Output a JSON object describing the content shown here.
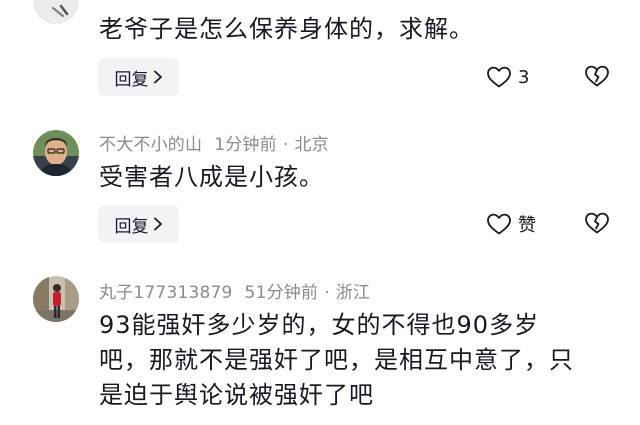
{
  "comments": [
    {
      "author": "",
      "time": "",
      "location": "",
      "text": "老爷子是怎么保养身体的，求解。",
      "reply_label": "回复",
      "like_count": "3"
    },
    {
      "author": "不大不小的山",
      "time": "1分钟前",
      "dot": "·",
      "location": "北京",
      "text": "受害者八成是小孩。",
      "reply_label": "回复",
      "like_count": "赞"
    },
    {
      "author": "丸子177313879",
      "time": "51分钟前",
      "dot": "·",
      "location": "浙江",
      "text_lines": [
        "93能强奸多少岁的，女的不得也90多岁",
        "吧，那就不是强奸了吧，是相互中意了，只",
        "是迫于舆论说被强奸了吧"
      ]
    }
  ],
  "icons": {
    "like": "heart-outline-icon",
    "dislike": "broken-heart-icon",
    "reply_chevron": "chevron-right-icon"
  },
  "colors": {
    "text": "#161823",
    "meta": "#8a8b91",
    "reply_bg": "#f3f3f5"
  }
}
